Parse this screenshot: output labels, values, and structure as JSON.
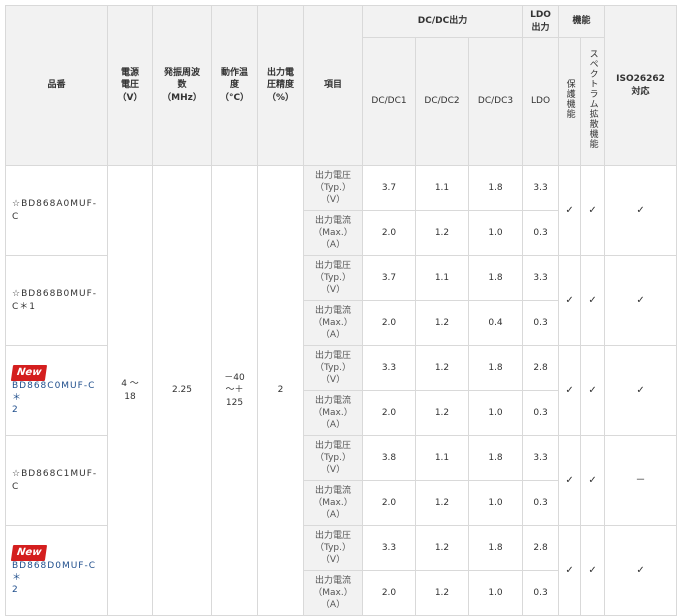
{
  "headers": {
    "part": "品番",
    "voltage": "電源\n電圧\n（V）",
    "freq": "発振周波\n数\n（MHz）",
    "temp": "動作温\n度\n（°C）",
    "accuracy": "出力電\n圧精度\n（%）",
    "item": "項目",
    "dcdc_group": "DC/DC出力",
    "ldo_group": "LDO\n出力",
    "func_group": "機能",
    "iso": "ISO26262\n対応",
    "dc1": "DC/DC1",
    "dc2": "DC/DC2",
    "dc3": "DC/DC3",
    "ldo": "LDO",
    "protect": "保護機能",
    "spread": "スペクトラム拡散機能"
  },
  "shared": {
    "voltage": "4 ～\n18",
    "freq": "2.25",
    "temp": "－40\n～＋\n125",
    "accuracy": "2"
  },
  "items": {
    "vout": "出力電圧\n（Typ.）\n（V）",
    "iout": "出力電流\n（Max.）\n（A）"
  },
  "new_badge": "New",
  "check_mark": "✓",
  "dash": "－",
  "products": [
    {
      "part": "☆BD868A0MUF-\nC",
      "is_new": false,
      "vout": [
        "3.7",
        "1.1",
        "1.8",
        "3.3"
      ],
      "iout": [
        "2.0",
        "1.2",
        "1.0",
        "0.3"
      ],
      "protect": "✓",
      "spread": "✓",
      "iso": "✓"
    },
    {
      "part": "☆BD868B0MUF-\nC＊1",
      "is_new": false,
      "vout": [
        "3.7",
        "1.1",
        "1.8",
        "3.3"
      ],
      "iout": [
        "2.0",
        "1.2",
        "0.4",
        "0.3"
      ],
      "protect": "✓",
      "spread": "✓",
      "iso": "✓"
    },
    {
      "part": "BD868C0MUF-C＊\n2",
      "is_new": true,
      "vout": [
        "3.3",
        "1.2",
        "1.8",
        "2.8"
      ],
      "iout": [
        "2.0",
        "1.2",
        "1.0",
        "0.3"
      ],
      "protect": "✓",
      "spread": "✓",
      "iso": "✓"
    },
    {
      "part": "☆BD868C1MUF-\nC",
      "is_new": false,
      "vout": [
        "3.8",
        "1.1",
        "1.8",
        "3.3"
      ],
      "iout": [
        "2.0",
        "1.2",
        "1.0",
        "0.3"
      ],
      "protect": "✓",
      "spread": "✓",
      "iso": "－"
    },
    {
      "part": "BD868D0MUF-C＊\n2",
      "is_new": true,
      "vout": [
        "3.3",
        "1.2",
        "1.8",
        "2.8"
      ],
      "iout": [
        "2.0",
        "1.2",
        "1.0",
        "0.3"
      ],
      "protect": "✓",
      "spread": "✓",
      "iso": "✓"
    }
  ]
}
